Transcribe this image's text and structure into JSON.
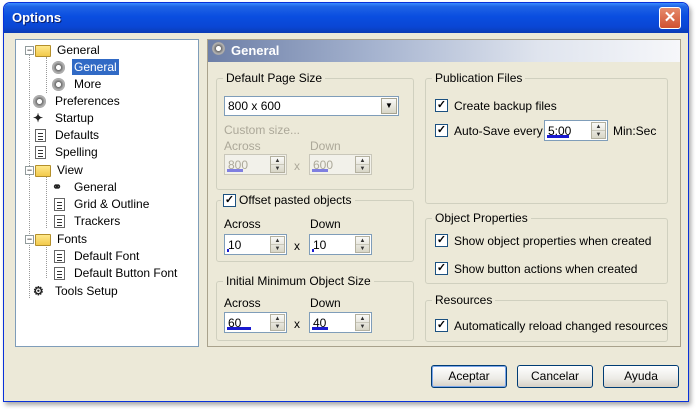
{
  "window": {
    "title": "Options",
    "close_glyph": "✕"
  },
  "tree": {
    "items": [
      {
        "label": "General",
        "icon": "folder-icon"
      },
      {
        "label": "General",
        "icon": "gear-icon",
        "selected": true
      },
      {
        "label": "More",
        "icon": "gear-icon"
      },
      {
        "label": "Preferences",
        "icon": "preferences-icon"
      },
      {
        "label": "Startup",
        "icon": "startup-icon"
      },
      {
        "label": "Defaults",
        "icon": "defaults-icon"
      },
      {
        "label": "Spelling",
        "icon": "spelling-icon"
      },
      {
        "label": "View",
        "icon": "folder-icon"
      },
      {
        "label": "General",
        "icon": "binoculars-icon"
      },
      {
        "label": "Grid & Outline",
        "icon": "grid-icon"
      },
      {
        "label": "Trackers",
        "icon": "trackers-icon"
      },
      {
        "label": "Fonts",
        "icon": "folder-icon"
      },
      {
        "label": "Default Font",
        "icon": "font-icon"
      },
      {
        "label": "Default Button Font",
        "icon": "font-icon"
      },
      {
        "label": "Tools Setup",
        "icon": "tools-icon"
      }
    ],
    "expander_minus": "−"
  },
  "panel": {
    "title": "General"
  },
  "page_size": {
    "title": "Default Page Size",
    "selected": "800 x 600",
    "dropdown_glyph": "▼",
    "custom_label": "Custom size...",
    "across_label": "Across",
    "down_label": "Down",
    "across_value": "800",
    "down_value": "600",
    "times": "x"
  },
  "offset": {
    "checkbox_label": "Offset pasted objects",
    "checked": true,
    "across_label": "Across",
    "down_label": "Down",
    "across_value": "10",
    "down_value": "10",
    "times": "x"
  },
  "min_size": {
    "title": "Initial Minimum Object Size",
    "across_label": "Across",
    "down_label": "Down",
    "across_value": "60",
    "down_value": "40",
    "times": "x"
  },
  "publication": {
    "title": "Publication Files",
    "backup_label": "Create backup files",
    "backup_checked": true,
    "autosave_label": "Auto-Save every",
    "autosave_checked": true,
    "autosave_value": "5:00",
    "autosave_unit": "Min:Sec"
  },
  "object_props": {
    "title": "Object Properties",
    "show_props_label": "Show object properties when created",
    "show_props_checked": true,
    "show_actions_label": "Show button actions when created",
    "show_actions_checked": true
  },
  "resources": {
    "title": "Resources",
    "reload_label": "Automatically reload changed resources",
    "reload_checked": true
  },
  "buttons": {
    "accept": "Aceptar",
    "cancel": "Cancelar",
    "help": "Ayuda"
  },
  "glyphs": {
    "check": "✓",
    "up": "▲",
    "down": "▼"
  },
  "colors": {
    "titlebar": "#0a4ee0",
    "selection": "#316ac5",
    "spin_bar": "#1a1ad0",
    "panel_bg": "#ece9d8"
  }
}
